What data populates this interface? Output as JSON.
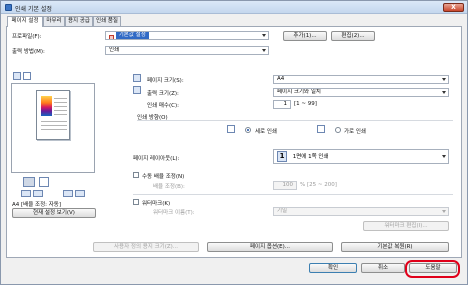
{
  "window": {
    "title": "인쇄 기본 설정",
    "close_label": "X"
  },
  "tabs": [
    {
      "label": "페이지 설정"
    },
    {
      "label": "마무리"
    },
    {
      "label": "용지 공급원"
    },
    {
      "label": "인쇄 품질"
    }
  ],
  "profile": {
    "label": "프로파일(F):",
    "value": "기본값 설정",
    "add_button": "추가(1)...",
    "edit_button": "편집(2)..."
  },
  "output_method": {
    "label": "출력 방법(M):",
    "value": "인쇄"
  },
  "preview": {
    "status_text": "A4 [배율 조정: 자동]",
    "settings_button": "현재 설정 보기(V)"
  },
  "page_size": {
    "label": "페이지 크기(S):",
    "value": "A4"
  },
  "output_size": {
    "label": "출력 크기(Z):",
    "value": "페이지 크기와 일치"
  },
  "copies": {
    "label": "인쇄 매수(C):",
    "value": "1",
    "range": "[1 ~ 99]"
  },
  "orientation": {
    "label": "인쇄 방향(O)",
    "portrait": "세로 인쇄",
    "landscape": "가로 인쇄",
    "selected": "portrait"
  },
  "page_layout": {
    "label": "페이지 레이아웃(L):",
    "value": "1면에 1쪽 인쇄",
    "number": "1"
  },
  "manual_scaling": {
    "label": "수동 배율 조정(N)",
    "sub_label": "배율 조정(B):",
    "value": "100",
    "range": "% [25 ~ 200]"
  },
  "watermark": {
    "label": "워터마크(K)",
    "sub_label": "워터마크 이름(T):",
    "value": "기밀",
    "edit_button": "워터마크 편집(I)..."
  },
  "bottom_buttons": {
    "custom_size": "사용자 정의 용지 크기(Z)...",
    "page_options": "페이지 옵션(E)...",
    "restore": "기본값 복원(R)"
  },
  "dialog_buttons": {
    "ok": "확인",
    "cancel": "취소",
    "help": "도움말"
  },
  "colors": {
    "accent": "#316ac5",
    "highlight_ring": "#e0001a"
  }
}
